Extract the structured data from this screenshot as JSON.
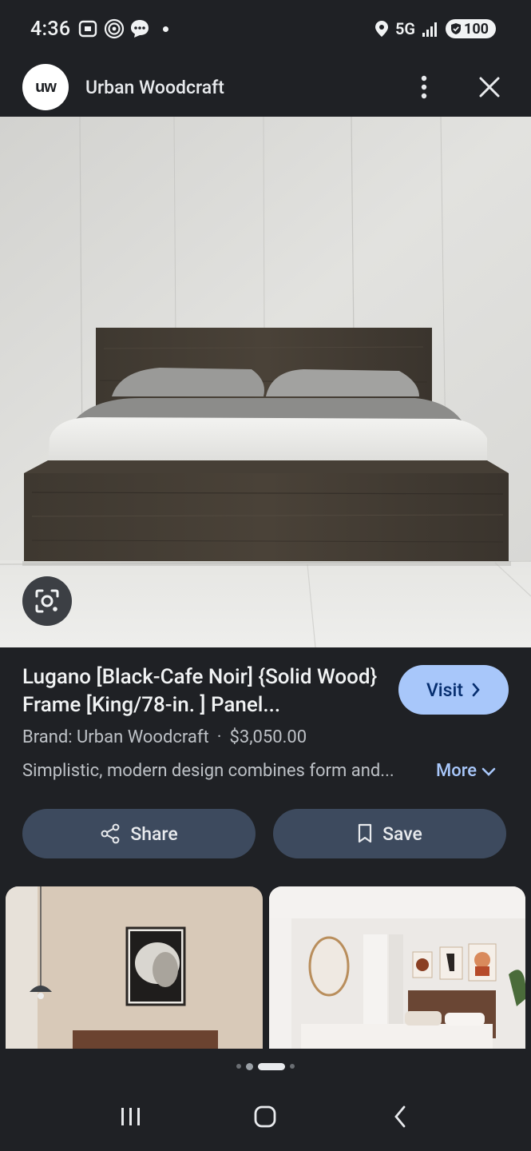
{
  "status_bar": {
    "time": "4:36",
    "network": "5G",
    "battery": "100"
  },
  "header": {
    "avatar_text": "uw",
    "title": "Urban Woodcraft"
  },
  "product": {
    "title": "Lugano [Black-Cafe Noir] {Solid Wood} Frame [King/78-in. ] Panel...",
    "brand": "Brand: Urban Woodcraft",
    "separator": "·",
    "price": "$3,050.00",
    "description": "Simplistic, modern design combines form and...",
    "more_label": "More",
    "visit_label": "Visit"
  },
  "actions": {
    "share_label": "Share",
    "save_label": "Save"
  },
  "pager": {
    "count": 4,
    "active_index": 2
  },
  "colors": {
    "background": "#1f2125",
    "visit_button": "#a8c7fa",
    "pill_button": "#3d4a5e",
    "link": "#a8c7fa"
  }
}
